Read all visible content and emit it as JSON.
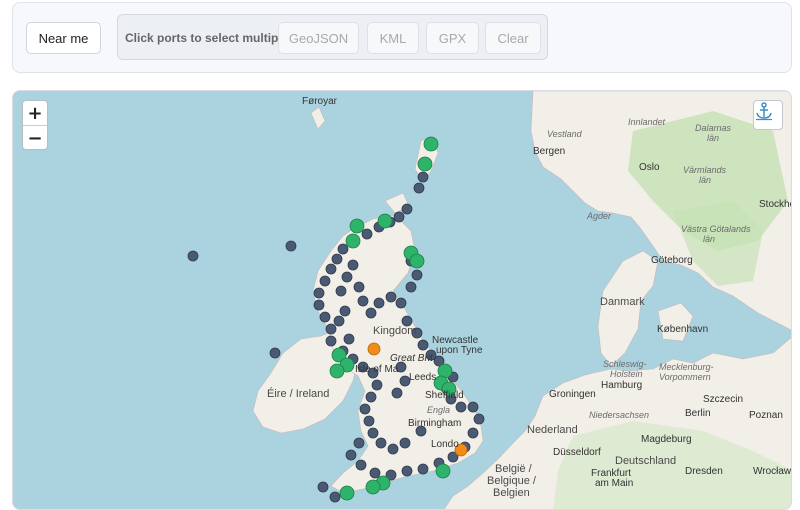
{
  "toolbar": {
    "near_me_label": "Near me",
    "hint": "Click ports to select multiple",
    "export_buttons": [
      "GeoJSON",
      "KML",
      "GPX",
      "Clear"
    ]
  },
  "map": {
    "zoom_in": "+",
    "zoom_out": "−",
    "colors": {
      "sea": "#aad3df",
      "land": "#f2efe9",
      "forest": "#c8e2b6",
      "port": "#4a5a73",
      "selected": "#27ae60",
      "highlight": "#f28c18"
    },
    "labels": {
      "faroe": "Føroyar",
      "vestland": "Vestland",
      "bergen": "Bergen",
      "oslo": "Oslo",
      "innlandet": "Innlandet",
      "dalarnas": "Dalarnas",
      "lan1": "län",
      "varmlands": "Värmlands",
      "lan2": "län",
      "stockholm": "Stockho",
      "agder": "Agder",
      "vastra": "Västra Götalands",
      "lan3": "län",
      "goteborg": "Göteborg",
      "danmark": "Danmark",
      "kobenhavn": "København",
      "kingdom": "Kingdom",
      "newcastle": "Newcastle",
      "upon_tyne": "upon Tyne",
      "great_britain": "Great Brit",
      "isle_man": "Isle of Ma",
      "eire": "Éire / Ireland",
      "leeds": "Leeds",
      "sheffield": "Sheffield",
      "england": "Engla",
      "birmingham": "Birmingham",
      "london": "Londo",
      "schleswig": "Schleswig-",
      "holstein": "Holstein",
      "mecklenburg": "Mecklenburg-",
      "vorpommern": "Vorpommern",
      "hamburg": "Hamburg",
      "groningen": "Groningen",
      "niedersachsen": "Niedersachsen",
      "nederland": "Nederland",
      "berlin": "Berlin",
      "poznan": "Poznan",
      "szczecin": "Szczecin",
      "magdeburg": "Magdeburg",
      "dusseldorf": "Düsseldorf",
      "deutschland": "Deutschland",
      "belgie": "België /",
      "belgique": "Belgique /",
      "belgien": "Belgien",
      "frankfurt": "Frankfurt",
      "am_main": "am Main",
      "dresden": "Dresden",
      "wroclaw": "Wrocław"
    }
  }
}
